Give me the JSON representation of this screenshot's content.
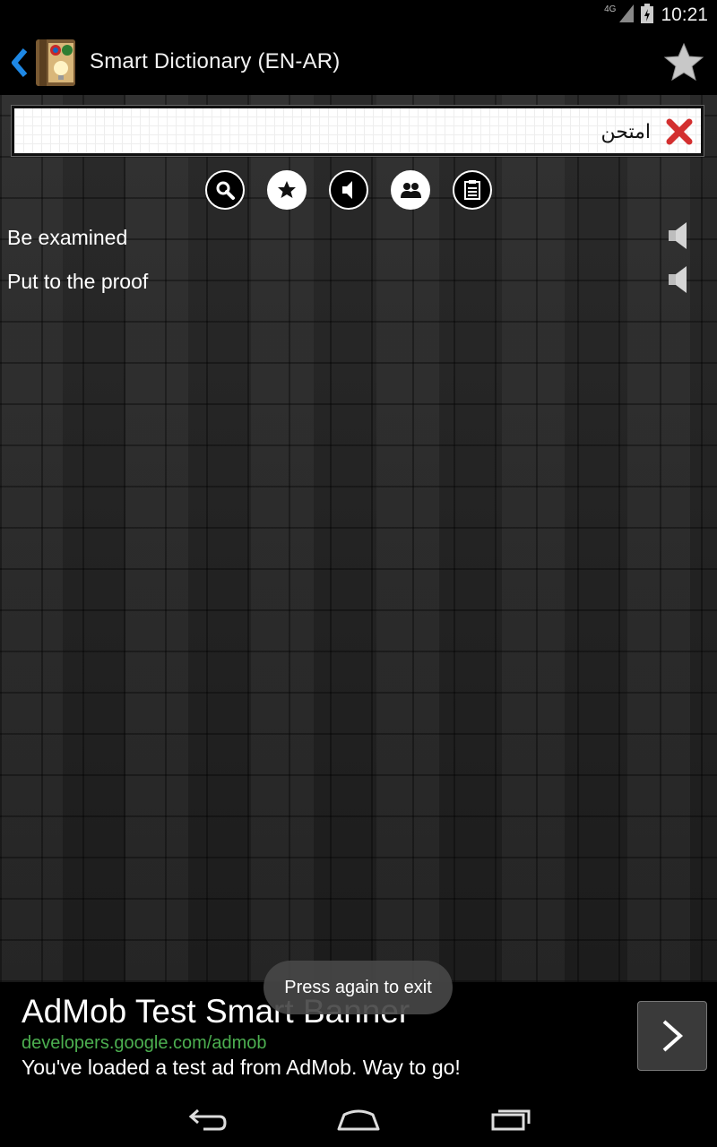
{
  "status_bar": {
    "network": "4G",
    "time": "10:21"
  },
  "action_bar": {
    "title": "Smart Dictionary (EN-AR)"
  },
  "search": {
    "value": "امتحن"
  },
  "results": [
    {
      "text": "Be examined"
    },
    {
      "text": "Put to the proof"
    }
  ],
  "ad": {
    "title": "AdMob Test Smart Banner",
    "url": "developers.google.com/admob",
    "description": "You've loaded a test ad from AdMob. Way to go!"
  },
  "toast": {
    "message": "Press again to exit"
  },
  "colors": {
    "ad_url": "#4caf50",
    "clear_icon": "#d32f2f",
    "up_caret": "#1e88e5"
  }
}
